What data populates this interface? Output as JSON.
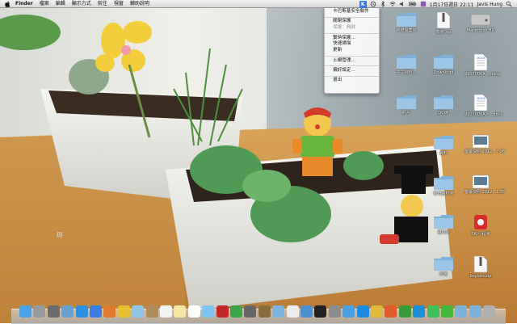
{
  "menubar": {
    "apple_icon": "apple-icon",
    "items": [
      "Finder",
      "檔案",
      "編輯",
      "顯示方式",
      "前往",
      "視窗",
      "輔助說明"
    ],
    "clock": "1月17日週日  22:11",
    "user": "Javis Hung",
    "status_icons": [
      "kaspersky-icon",
      "timemachine-icon",
      "bluetooth-icon",
      "wifi-icon",
      "volume-icon",
      "battery-icon",
      "input-icon"
    ]
  },
  "dropdown": {
    "items": [
      "卡巴斯基安全軟件",
      "關閉保護",
      "保護：開啟",
      "實時保護…",
      "快速掃描",
      "更新",
      "上網管理…",
      "偏好設定…",
      "退出"
    ]
  },
  "desktop": {
    "icons": [
      {
        "label": "新增檔案夾",
        "kind": "folder"
      },
      {
        "label": "安裝.zip",
        "kind": "zip"
      },
      {
        "label": "Macintosh HD",
        "kind": "hd"
      },
      {
        "label": "中文資料...",
        "kind": "folder"
      },
      {
        "label": "Download",
        "kind": "folder"
      },
      {
        "label": "9907006A ...docx",
        "kind": "doc"
      },
      {
        "label": "照片",
        "kind": "folder"
      },
      {
        "label": "DCIM",
        "kind": "folder"
      },
      {
        "label": "9907006A.f ...docx",
        "kind": "doc"
      },
      {
        "label": "資料",
        "kind": "folder"
      },
      {
        "label": "螢幕快照 2012...7.06",
        "kind": "screen"
      },
      {
        "label": "新增資料夾",
        "kind": "folder"
      },
      {
        "label": "螢幕快照 2012...1.35",
        "kind": "screen"
      },
      {
        "label": "資料夾",
        "kind": "folder"
      },
      {
        "label": "SKI小程序",
        "kind": "app"
      },
      {
        "label": "學校",
        "kind": "folder"
      },
      {
        "label": "bsplots.zip",
        "kind": "zip"
      }
    ]
  },
  "watermark": "BJ",
  "dock": {
    "items": [
      "finder-icon",
      "launchpad-icon",
      "mission-control-icon",
      "iphoto-icon",
      "appstore-icon",
      "safari-icon",
      "firefox-icon",
      "chrome-icon",
      "mail-icon",
      "contacts-icon",
      "calendar-icon",
      "notes-icon",
      "reminders-icon",
      "itunes-icon",
      "photo-booth-icon",
      "facetime-icon",
      "image-capture-icon",
      "tools-icon",
      "preview-icon",
      "textedit-icon",
      "xcode-icon",
      "terminal-icon",
      "system-preferences-icon",
      "flashcard-icon",
      "qq-icon",
      "word-icon",
      "powerpoint-icon",
      "excel-icon",
      "kaspersky-icon",
      "line-icon",
      "wechat-icon",
      "folder-icon",
      "downloads-icon",
      "trash-icon"
    ]
  }
}
